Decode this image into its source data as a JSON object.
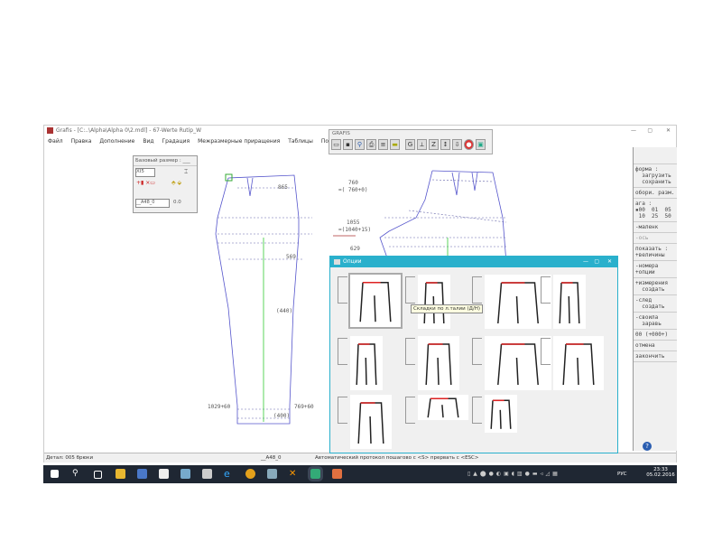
{
  "window": {
    "title": "Grafis - [C:..\\Alpha\\Alpha 0\\2.mdl] - 67-Werte Rutip_W"
  },
  "menu": [
    "Файл",
    "Правка",
    "Дополнение",
    "Вид",
    "Градация",
    "Межразмерные приращения",
    "Таблицы",
    "Помощь"
  ],
  "grafis_toolbar": {
    "title": "GRAFIS",
    "icons": [
      "open-icon",
      "save-icon",
      "zoom-icon",
      "print-icon",
      "grid-icon",
      "ruler-icon",
      "g-icon",
      "measure-icon",
      "z-icon",
      "move-icon",
      "export-icon",
      "stop-icon",
      "monitor-icon"
    ]
  },
  "base_panel": {
    "title": "Базовый размер : ___",
    "size": "XI5",
    "field": "__A48_0",
    "value": "0.0"
  },
  "drawing": {
    "labels": [
      "865",
      "569",
      "(440)",
      "1029+60",
      "769+60",
      "(400)",
      "760",
      "=( 760+0)",
      "1055",
      "=(1040+15)",
      "629"
    ]
  },
  "right_panel": [
    "форма :\n  загрузить\n  сохранить",
    "обори. разм.",
    "ага :\n▪00  01  05\n 10  25  50",
    "-маленк",
    "-ось",
    "показать :\n+величины",
    "-номера\n+опции",
    "+измерения\n  создать",
    "-след\n  создать",
    "-своила\n  заравь",
    "00 (+000+)",
    "отмена",
    "закончить"
  ],
  "status": {
    "detail": "Детал: 005 брюки",
    "field": "__A48_0",
    "message": "Автоматический протокол пошагово с <S> прервать с <ESC>"
  },
  "options_dialog": {
    "title": "Опции",
    "tooltip": "Складки по л.талии (Д/Н)"
  },
  "taskbar": {
    "lang": "РУС",
    "time": "23:33",
    "date": "05.02.2016"
  }
}
